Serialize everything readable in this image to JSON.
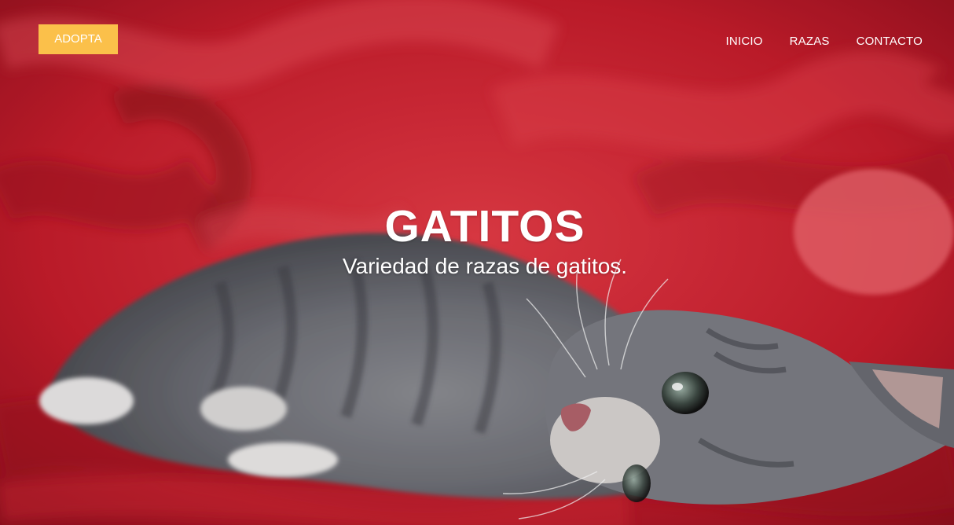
{
  "header": {
    "adopt_label": "ADOPTA",
    "nav": [
      {
        "label": "INICIO"
      },
      {
        "label": "RAZAS"
      },
      {
        "label": "CONTACTO"
      }
    ]
  },
  "hero": {
    "title": "GATITOS",
    "subtitle": "Variedad de razas de gatitos.",
    "background_image": "kitten-on-red-blanket",
    "accent_color": "#fbc04a",
    "background_color": "#c81f2e",
    "text_color": "#ffffff"
  }
}
